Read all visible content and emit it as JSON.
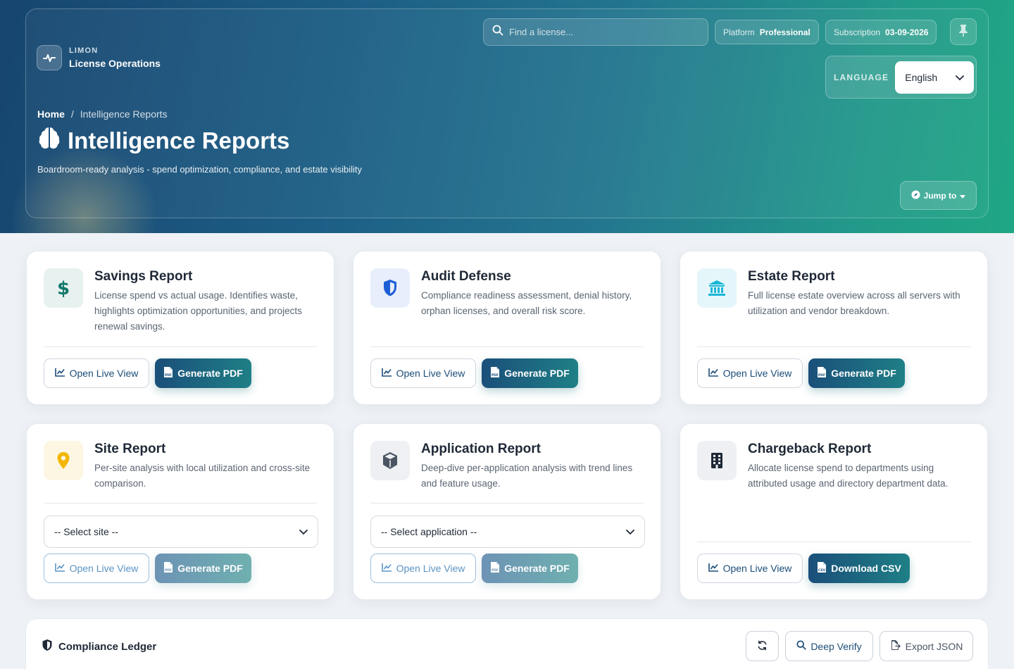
{
  "header": {
    "brand_eyebrow": "LIMON",
    "brand_name": "License Operations",
    "search_placeholder": "Find a license...",
    "platform_label": "Platform",
    "platform_value": "Professional",
    "subscription_label": "Subscription",
    "subscription_value": "03-09-2026",
    "language_label": "LANGUAGE",
    "language_value": "English",
    "breadcrumb": {
      "home": "Home",
      "separator": "/",
      "current": "Intelligence Reports"
    },
    "title": "Intelligence Reports",
    "subtitle": "Boardroom-ready analysis - spend optimization, compliance, and estate visibility",
    "jump_label": "Jump to"
  },
  "cards": [
    {
      "title": "Savings Report",
      "desc": "License spend vs actual usage. Identifies waste, highlights optimization opportunities, and projects renewal savings.",
      "live": "Open Live View",
      "action": "Generate PDF",
      "icon": "dollar-icon",
      "tint": "#e7f1ef",
      "icon_color": "#12786c"
    },
    {
      "title": "Audit Defense",
      "desc": "Compliance readiness assessment, denial history, orphan licenses, and overall risk score.",
      "live": "Open Live View",
      "action": "Generate PDF",
      "icon": "shield-icon",
      "tint": "#e8eefb",
      "icon_color": "#1d5fd6"
    },
    {
      "title": "Estate Report",
      "desc": "Full license estate overview across all servers with utilization and vendor breakdown.",
      "live": "Open Live View",
      "action": "Generate PDF",
      "icon": "building-columns-icon",
      "tint": "#e5f6fb",
      "icon_color": "#19b6d6"
    },
    {
      "title": "Site Report",
      "desc": "Per-site analysis with local utilization and cross-site comparison.",
      "select": "-- Select site --",
      "live": "Open Live View",
      "action": "Generate PDF",
      "icon": "map-pin-icon",
      "tint": "#fdf6e3",
      "icon_color": "#f2b705"
    },
    {
      "title": "Application Report",
      "desc": "Deep-dive per-application analysis with trend lines and feature usage.",
      "select": "-- Select application --",
      "live": "Open Live View",
      "action": "Generate PDF",
      "icon": "cube-icon",
      "tint": "#eef0f3",
      "icon_color": "#4b5563"
    },
    {
      "title": "Chargeback Report",
      "desc": "Allocate license spend to departments using attributed usage and directory department data.",
      "live": "Open Live View",
      "action": "Download CSV",
      "icon": "building-icon",
      "tint": "#eef0f3",
      "icon_color": "#1f2937"
    }
  ],
  "ledger": {
    "title": "Compliance Ledger",
    "verify_label": "Deep Verify",
    "export_label": "Export JSON"
  },
  "colors": {
    "primary": "#1a4f7a",
    "accent": "#1f7f86"
  }
}
